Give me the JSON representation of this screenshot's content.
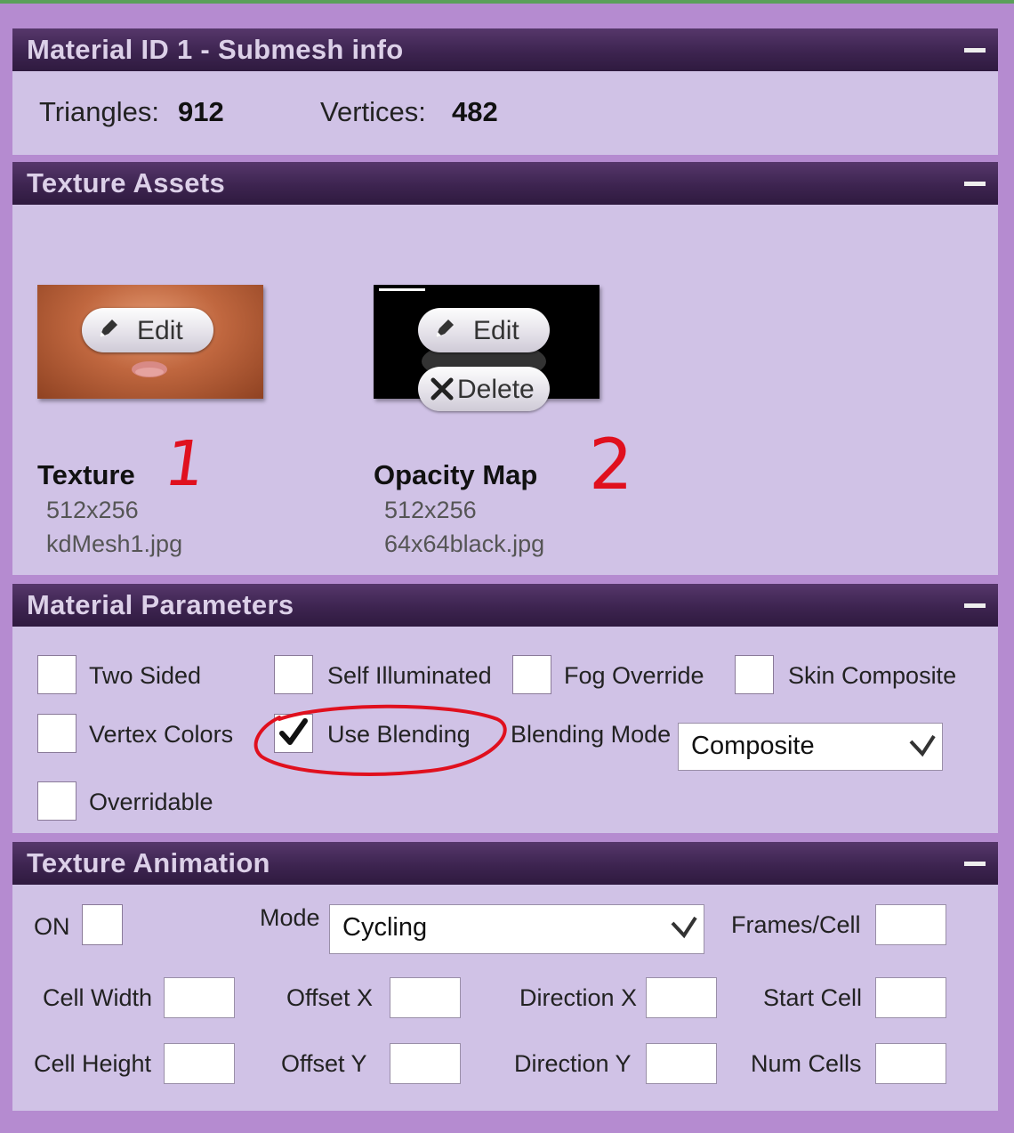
{
  "submesh": {
    "title": "Material ID 1 - Submesh info",
    "triangles_label": "Triangles:",
    "triangles_value": "912",
    "vertices_label": "Vertices:",
    "vertices_value": "482"
  },
  "textures": {
    "title": "Texture Assets",
    "items": [
      {
        "name": "Texture",
        "size": "512x256",
        "file": "kdMesh1.jpg",
        "edit_label": "Edit",
        "annotation": "1"
      },
      {
        "name": "Opacity Map",
        "size": "512x256",
        "file": "64x64black.jpg",
        "edit_label": "Edit",
        "delete_label": "Delete",
        "annotation": "2"
      }
    ]
  },
  "material": {
    "title": "Material Parameters",
    "checkboxes": {
      "two_sided": {
        "label": "Two Sided",
        "checked": false
      },
      "self_illuminated": {
        "label": "Self Illuminated",
        "checked": false
      },
      "fog_override": {
        "label": "Fog Override",
        "checked": false
      },
      "skin_composite": {
        "label": "Skin Composite",
        "checked": false
      },
      "vertex_colors": {
        "label": "Vertex Colors",
        "checked": false
      },
      "use_blending": {
        "label": "Use Blending",
        "checked": true
      },
      "overridable": {
        "label": "Overridable",
        "checked": false
      }
    },
    "blending_mode_label": "Blending Mode",
    "blending_mode_value": "Composite"
  },
  "animation": {
    "title": "Texture Animation",
    "on_label": "ON",
    "mode_label": "Mode",
    "mode_value": "Cycling",
    "frames_cell_label": "Frames/Cell",
    "cell_width_label": "Cell Width",
    "offset_x_label": "Offset X",
    "direction_x_label": "Direction X",
    "start_cell_label": "Start Cell",
    "cell_height_label": "Cell Height",
    "offset_y_label": "Offset Y",
    "direction_y_label": "Direction Y",
    "num_cells_label": "Num Cells"
  },
  "colors": {
    "page_bg": "#b58bd0",
    "panel_bg": "#d0c2e6",
    "header_bg": "#3d2450",
    "annotation_red": "#e0101e"
  },
  "icons": [
    "pencil-icon",
    "x-icon",
    "checkmark-icon",
    "chevron-down-icon",
    "collapse-icon"
  ]
}
